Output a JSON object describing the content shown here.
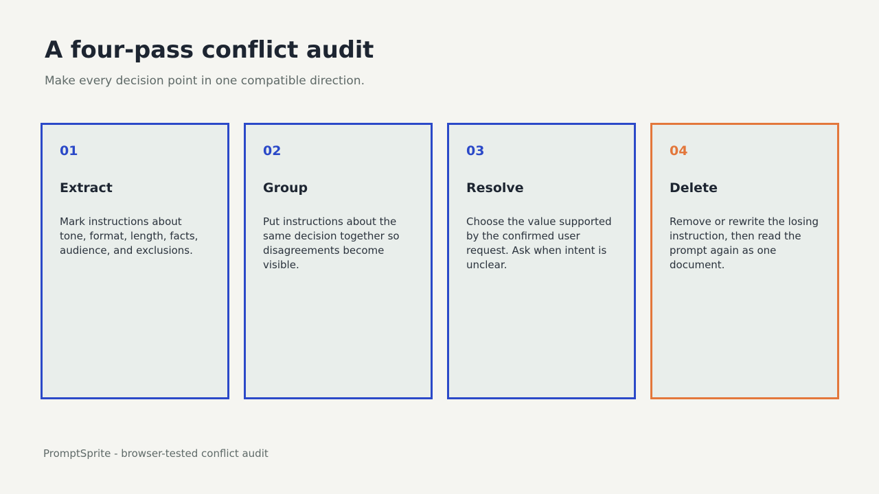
{
  "slide": {
    "title": "A four-pass conflict audit",
    "subtitle": "Make every decision point in one compatible direction."
  },
  "colors": {
    "background": "#f5f5f1",
    "card_fill": "#e9eeeb",
    "accent_blue": "#2b49c8",
    "accent_orange": "#e3773b",
    "heading_text": "#1d2531",
    "muted_text": "#5f6a68"
  },
  "cards": [
    {
      "number": "01",
      "title": "Extract",
      "description": "Mark instructions about tone, format, length, facts, audience, and exclusions.",
      "accent": "blue"
    },
    {
      "number": "02",
      "title": "Group",
      "description": "Put instructions about the same decision together so disagreements become visible.",
      "accent": "blue"
    },
    {
      "number": "03",
      "title": "Resolve",
      "description": "Choose the value supported by the confirmed user request. Ask when intent is unclear.",
      "accent": "blue"
    },
    {
      "number": "04",
      "title": "Delete",
      "description": "Remove or rewrite the losing instruction, then read the prompt again as one document.",
      "accent": "orange"
    }
  ],
  "footer": {
    "text": "PromptSprite - browser-tested conflict audit"
  }
}
